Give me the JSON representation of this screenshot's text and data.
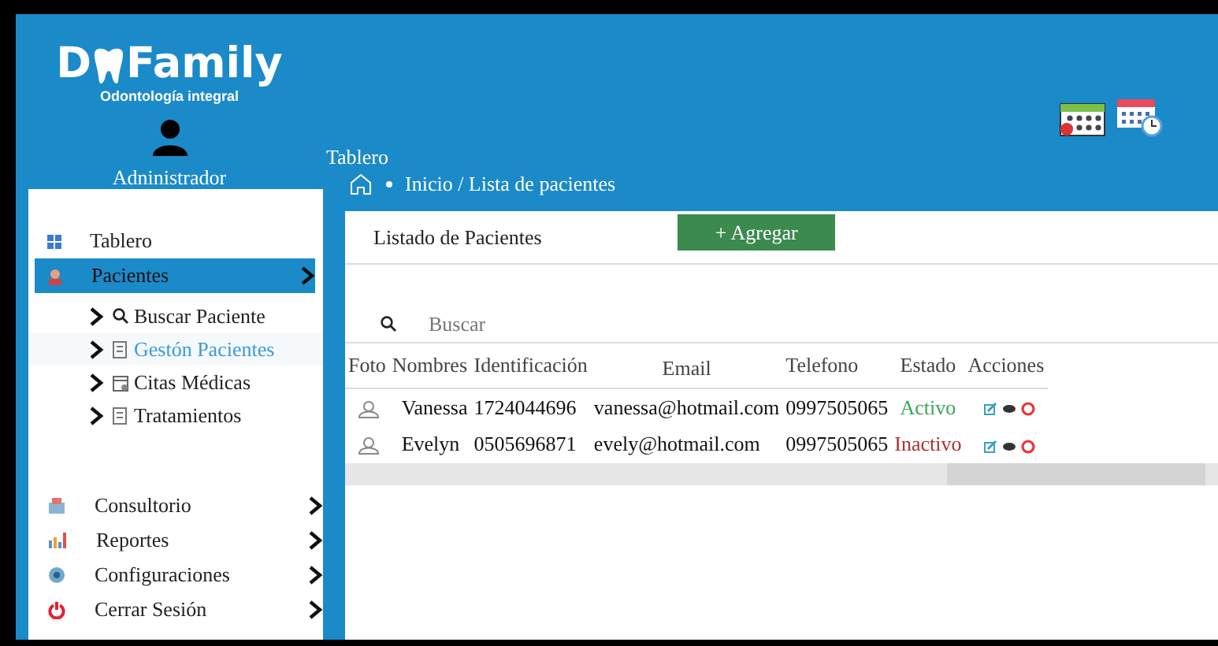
{
  "brand": {
    "letter": "D",
    "name": "Family",
    "tagline": "Odontología integral"
  },
  "user": {
    "name": "Adninistrador"
  },
  "page_title": "Tablero",
  "breadcrumb": "Inicio / Lista de pacientes",
  "sidebar": {
    "sections": [
      {
        "items": [
          {
            "label": "Tablero",
            "kind": "grid",
            "selected": false,
            "chevron": false
          },
          {
            "label": "Pacientes",
            "kind": "patient",
            "selected": true,
            "chevron": true,
            "children": [
              {
                "label": "Buscar Paciente",
                "kind": "search",
                "selected": false
              },
              {
                "label": "Gestón Pacientes",
                "kind": "doc",
                "selected": true
              },
              {
                "label": "Citas Médicas",
                "kind": "calendar",
                "selected": false
              },
              {
                "label": "Tratamientos",
                "kind": "doc",
                "selected": false
              }
            ]
          }
        ]
      },
      {
        "items": [
          {
            "label": "Consultorio",
            "kind": "clinic",
            "selected": false,
            "chevron": true
          },
          {
            "label": "Reportes",
            "kind": "chart",
            "selected": false,
            "chevron": true
          },
          {
            "label": "Configuraciones",
            "kind": "gear",
            "selected": false,
            "chevron": true
          },
          {
            "label": "Cerrar Sesión",
            "kind": "power",
            "selected": false,
            "chevron": true
          }
        ]
      }
    ]
  },
  "card": {
    "title": "Listado de Pacientes",
    "add_button": "+ Agregar",
    "search": {
      "placeholder": "Buscar"
    },
    "table": {
      "columns": [
        "Foto",
        "Nombres",
        "Identificación",
        "Email",
        "Telefono",
        "Estado",
        "Acciones"
      ],
      "rows": [
        {
          "nombres": "Vanessa",
          "identificacion": "1724044696",
          "email": "vanessa@hotmail.com",
          "telefono": "0997505065",
          "estado": "Activo",
          "active": true
        },
        {
          "nombres": "Evelyn",
          "identificacion": "0505696871",
          "email": "evely@hotmail.com",
          "telefono": "0997505065",
          "estado": "Inactivo",
          "active": false
        }
      ]
    }
  }
}
